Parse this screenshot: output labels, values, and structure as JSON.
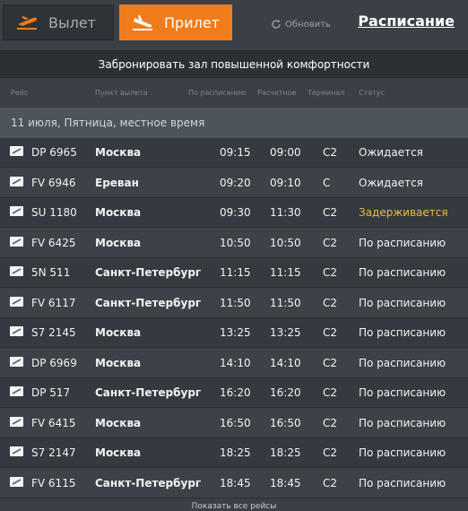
{
  "header": {
    "tab_departure": "Вылет",
    "tab_arrival": "Прилет",
    "tab_departure_icon": "plane-takeoff-icon",
    "tab_arrival_icon": "plane-landing-icon",
    "refresh_label": "Обновить",
    "schedule_link": "Расписание"
  },
  "banner": "Забронировать зал повышенной комфортности",
  "columns": {
    "flight": "Рейс",
    "origin": "Пункт вылета",
    "scheduled": "По расписанию",
    "estimated": "Расчетное",
    "terminal": "Терминал",
    "status": "Статус"
  },
  "date_label": "11 июля, Пятница, местное время",
  "flights": [
    {
      "airline_icon": "airline-dp-icon",
      "flight": "DP 6965",
      "city": "Москва",
      "scheduled": "09:15",
      "estimated": "09:00",
      "terminal": "C2",
      "status": "Ожидается",
      "delayed": false
    },
    {
      "airline_icon": "airline-fv-icon",
      "flight": "FV 6946",
      "city": "Ереван",
      "scheduled": "09:20",
      "estimated": "09:10",
      "terminal": "C",
      "status": "Ожидается",
      "delayed": false
    },
    {
      "airline_icon": "airline-su-icon",
      "flight": "SU 1180",
      "city": "Москва",
      "scheduled": "09:30",
      "estimated": "11:30",
      "terminal": "C2",
      "status": "Задерживается",
      "delayed": true
    },
    {
      "airline_icon": "airline-fv-icon",
      "flight": "FV 6425",
      "city": "Москва",
      "scheduled": "10:50",
      "estimated": "10:50",
      "terminal": "C2",
      "status": "По расписанию",
      "delayed": false
    },
    {
      "airline_icon": "airline-5n-icon",
      "flight": "5N 511",
      "city": "Санкт-Петербург",
      "scheduled": "11:15",
      "estimated": "11:15",
      "terminal": "C2",
      "status": "По расписанию",
      "delayed": false
    },
    {
      "airline_icon": "airline-fv-icon",
      "flight": "FV 6117",
      "city": "Санкт-Петербург",
      "scheduled": "11:50",
      "estimated": "11:50",
      "terminal": "C2",
      "status": "По расписанию",
      "delayed": false
    },
    {
      "airline_icon": "airline-s7-icon",
      "flight": "S7 2145",
      "city": "Москва",
      "scheduled": "13:25",
      "estimated": "13:25",
      "terminal": "C2",
      "status": "По расписанию",
      "delayed": false
    },
    {
      "airline_icon": "airline-dp-icon",
      "flight": "DP 6969",
      "city": "Москва",
      "scheduled": "14:10",
      "estimated": "14:10",
      "terminal": "C2",
      "status": "По расписанию",
      "delayed": false
    },
    {
      "airline_icon": "airline-dp-icon",
      "flight": "DP 517",
      "city": "Санкт-Петербург",
      "scheduled": "16:20",
      "estimated": "16:20",
      "terminal": "C2",
      "status": "По расписанию",
      "delayed": false
    },
    {
      "airline_icon": "airline-fv-icon",
      "flight": "FV 6415",
      "city": "Москва",
      "scheduled": "16:50",
      "estimated": "16:50",
      "terminal": "C2",
      "status": "По расписанию",
      "delayed": false
    },
    {
      "airline_icon": "airline-s7-icon",
      "flight": "S7 2147",
      "city": "Москва",
      "scheduled": "18:25",
      "estimated": "18:25",
      "terminal": "C2",
      "status": "По расписанию",
      "delayed": false
    },
    {
      "airline_icon": "airline-fv-icon",
      "flight": "FV 6115",
      "city": "Санкт-Петербург",
      "scheduled": "18:45",
      "estimated": "18:45",
      "terminal": "C2",
      "status": "По расписанию",
      "delayed": false
    }
  ],
  "footer_link": "Показать все рейсы",
  "colors": {
    "accent": "#f07c1c",
    "delayed": "#e9bc3e",
    "background": "#3b4047"
  }
}
